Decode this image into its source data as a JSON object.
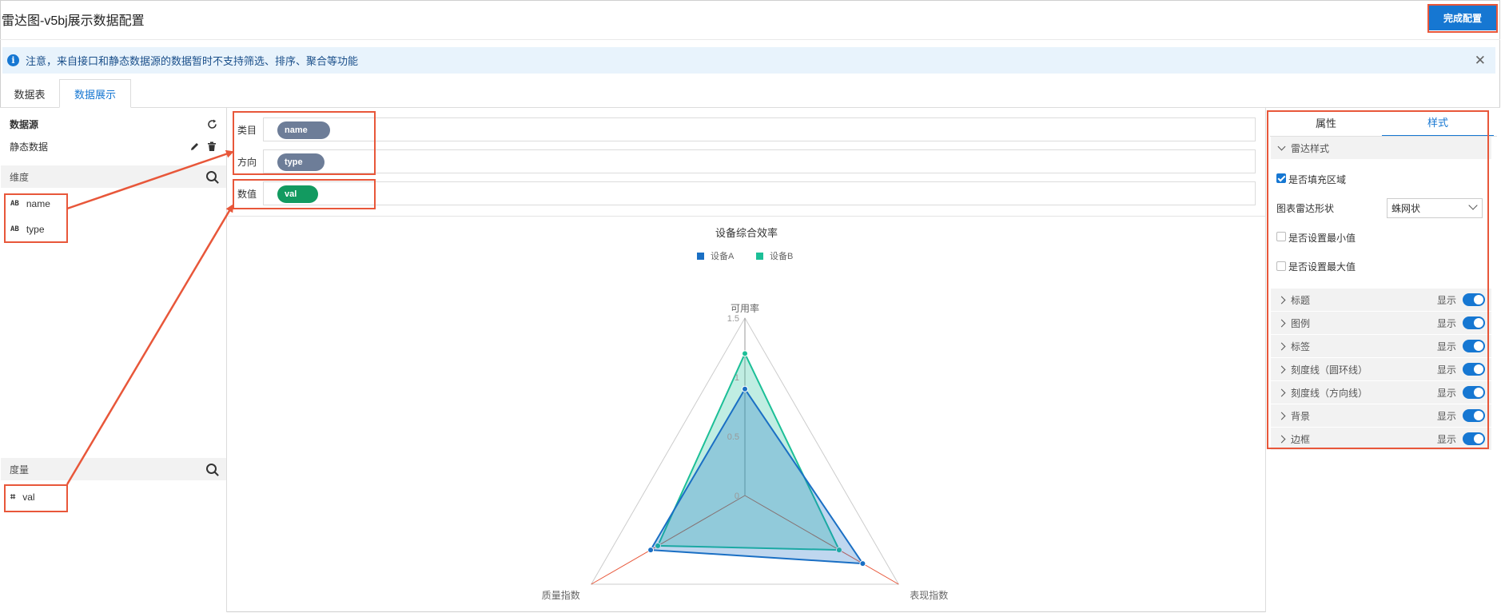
{
  "header": {
    "title": "雷达图-v5bj展示数据配置",
    "done_button": "完成配置"
  },
  "notice": {
    "icon": "info-icon",
    "text": "注意，来自接口和静态数据源的数据暂时不支持筛选、排序、聚合等功能"
  },
  "tabs": [
    {
      "label": "数据表",
      "active": false
    },
    {
      "label": "数据展示",
      "active": true
    }
  ],
  "left_panel": {
    "datasource_title": "数据源",
    "datasource_name": "静态数据",
    "dimension_title": "维度",
    "dimensions": [
      {
        "icon": "AB",
        "label": "name"
      },
      {
        "icon": "AB",
        "label": "type"
      }
    ],
    "measure_title": "度量",
    "measures": [
      {
        "icon": "⌗",
        "label": "val"
      }
    ]
  },
  "shelves": {
    "category": {
      "label": "类目",
      "field": "name"
    },
    "direction": {
      "label": "方向",
      "field": "type"
    },
    "value": {
      "label": "数值",
      "field": "val"
    }
  },
  "chart_data": {
    "type": "radar",
    "title": "设备综合效率",
    "indicators": [
      "可用率",
      "表现指数",
      "质量指数"
    ],
    "ticks": [
      "0",
      "0.5",
      "1",
      "1.5"
    ],
    "max": 1.5,
    "series": [
      {
        "name": "设备A",
        "color": "#1a6fc4",
        "values": [
          0.9,
          1.15,
          0.92
        ]
      },
      {
        "name": "设备B",
        "color": "#1cbf97",
        "values": [
          1.2,
          0.92,
          0.85
        ]
      }
    ],
    "legend_position": "top-center"
  },
  "right_panel": {
    "tabs": [
      {
        "label": "属性",
        "active": false
      },
      {
        "label": "样式",
        "active": true
      }
    ],
    "group_title": "雷达样式",
    "fill_area_label": "是否填充区域",
    "fill_area_checked": true,
    "shape_label": "图表雷达形状",
    "shape_value": "蛛网状",
    "min_label": "是否设置最小值",
    "min_checked": false,
    "max_label": "是否设置最大值",
    "max_checked": false,
    "sections": [
      {
        "label": "标题",
        "show": "显示",
        "on": true
      },
      {
        "label": "图例",
        "show": "显示",
        "on": true
      },
      {
        "label": "标签",
        "show": "显示",
        "on": true
      },
      {
        "label": "刻度线（圆环线）",
        "show": "显示",
        "on": true
      },
      {
        "label": "刻度线（方向线）",
        "show": "显示",
        "on": true
      },
      {
        "label": "背景",
        "show": "显示",
        "on": true
      },
      {
        "label": "边框",
        "show": "显示",
        "on": true
      }
    ]
  }
}
